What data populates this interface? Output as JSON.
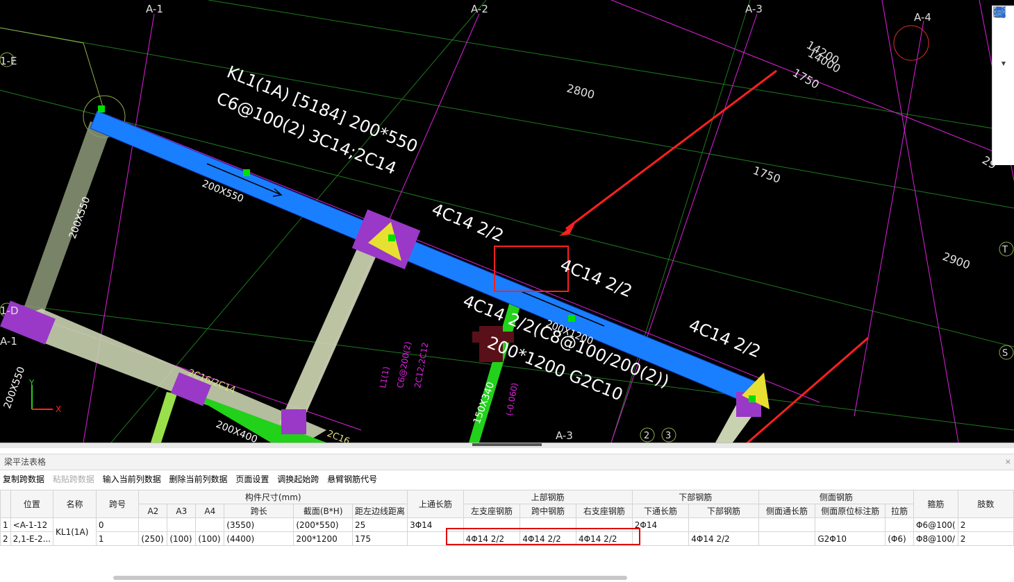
{
  "canvas": {
    "axis_labels": [
      "A-1",
      "A-2",
      "A-3",
      "A-4",
      "1-E",
      "1-D",
      "A-1",
      "A-3",
      "2",
      "3",
      "T",
      "S"
    ],
    "dims": [
      "2800",
      "1750",
      "1750",
      "2900",
      "14200",
      "14000",
      "29"
    ],
    "beam_main_label_1": "KL1(1A) [5184] 200*550",
    "beam_main_label_2": "C6@100(2) 3C14;2C14",
    "rebar_labels": [
      "4C14 2/2",
      "4C14 2/2",
      "4C14 2/2(C8@100/200(2))",
      "4C14 2/2",
      "200*1200 G2C10"
    ],
    "section_labels": [
      "200X550",
      "200X550",
      "200X1200",
      "200X400",
      "150X340",
      "200X550"
    ],
    "small_labels": [
      "L1(1)",
      "C6@200(2)",
      "2C12;2C12",
      "(-0.060)",
      "2C16/2C14",
      "2C16"
    ],
    "colors": {
      "beam_blue": "#1a7fff",
      "beam_green": "#22d11a",
      "axis_magenta": "#e020e0",
      "grid_green": "#1f7a1f",
      "arrow_red": "#ff2020",
      "label_white": "#ffffff",
      "label_yellow": "#e0e080"
    }
  },
  "panel": {
    "title": "梁平法表格",
    "close": "×",
    "toolbar": [
      "复制跨数据",
      "粘贴跨数据",
      "输入当前列数据",
      "删除当前列数据",
      "页面设置",
      "调换起始跨",
      "悬臂钢筋代号"
    ],
    "toolbar_disabled": [
      false,
      true,
      false,
      false,
      false,
      false,
      false
    ]
  },
  "grid": {
    "group_headers": {
      "size": "构件尺寸(mm)",
      "top": "上部钢筋",
      "bottom": "下部钢筋",
      "side": "侧面钢筋"
    },
    "headers": {
      "pos": "位置",
      "name": "名称",
      "span": "跨号",
      "a2": "A2",
      "a3": "A3",
      "a4": "A4",
      "len": "跨长",
      "sec": "截面(B*H)",
      "dist": "距左边线距离",
      "top_through": "上通长筋",
      "left_seat": "左支座钢筋",
      "mid": "跨中钢筋",
      "right_seat": "右支座钢筋",
      "bot_through": "下通长筋",
      "bot": "下部钢筋",
      "side_through": "侧面通长筋",
      "side_orig": "侧面原位标注筋",
      "tie": "拉筋",
      "stirrup": "箍筋",
      "legs": "肢数"
    },
    "rows": [
      {
        "idx": "1",
        "pos": "<A-1-12",
        "name": "KL1(1A)",
        "span": "0",
        "a2": "",
        "a3": "",
        "a4": "",
        "len": "(3550)",
        "sec": "(200*550)",
        "dist": "25",
        "top_through": "3Φ14",
        "left_seat": "",
        "mid": "",
        "right_seat": "",
        "bot_through": "2Φ14",
        "bot": "",
        "side_through": "",
        "side_orig": "",
        "tie": "",
        "stirrup": "Φ6@100(",
        "legs": "2"
      },
      {
        "idx": "2",
        "pos": "2,1-E-2...",
        "name": "",
        "span": "1",
        "a2": "(250)",
        "a3": "(100)",
        "a4": "(100)",
        "len": "(4400)",
        "sec": "200*1200",
        "dist": "175",
        "top_through": "",
        "left_seat": "4Φ14 2/2",
        "mid": "4Φ14 2/2",
        "right_seat": "4Φ14 2/2",
        "bot_through": "",
        "bot": "4Φ14 2/2",
        "side_through": "",
        "side_orig": "G2Φ10",
        "tie": "(Φ6)",
        "stirrup": "Φ8@100/",
        "legs": "2"
      }
    ]
  }
}
